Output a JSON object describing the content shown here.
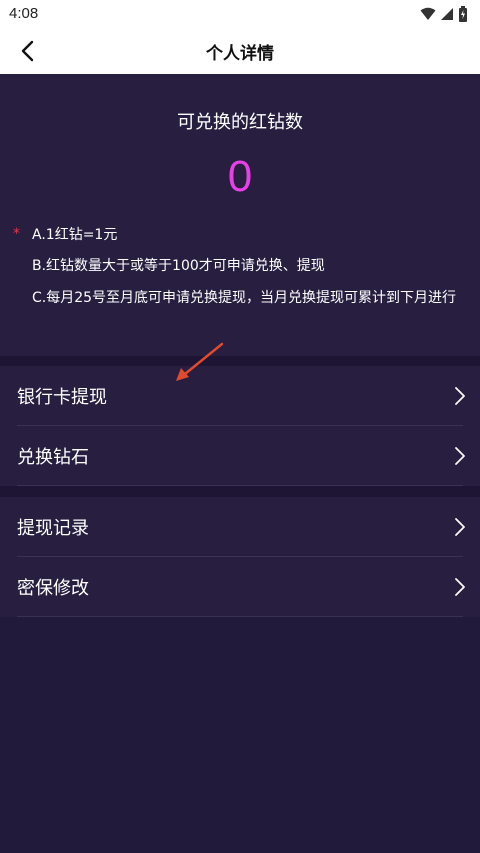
{
  "status_bar": {
    "time": "4:08",
    "icons": [
      "wifi-icon",
      "signal-icon",
      "battery-icon"
    ]
  },
  "nav": {
    "title": "个人详情",
    "back_icon": "chevron-left-icon"
  },
  "balance": {
    "label": "可兑换的红钻数",
    "value": "0",
    "value_color": "#e93fe8"
  },
  "notes": {
    "marker": "*",
    "items": [
      "A.1红钻=1元",
      "B.红钻数量大于或等于100才可申请兑换、提现",
      "C.每月25号至月底可申请兑换提现，当月兑换提现可累计到下月进行"
    ]
  },
  "menu_group_1": [
    {
      "label": "银行卡提现",
      "icon": "chevron-right-icon"
    },
    {
      "label": "兑换钻石",
      "icon": "chevron-right-icon"
    }
  ],
  "menu_group_2": [
    {
      "label": "提现记录",
      "icon": "chevron-right-icon"
    },
    {
      "label": "密保修改",
      "icon": "chevron-right-icon"
    }
  ],
  "colors": {
    "background": "#221a3b",
    "panel": "#271e40",
    "accent": "#e93fe8",
    "annotation_arrow": "#e04a2f"
  }
}
